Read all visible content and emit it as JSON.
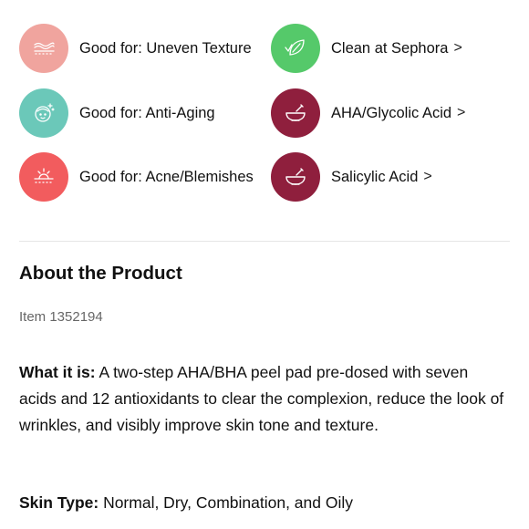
{
  "highlights": [
    {
      "label": "Good for: Uneven Texture",
      "icon": "uneven-texture-icon",
      "color": "#f0a49e",
      "link": false
    },
    {
      "label": "Clean at Sephora",
      "icon": "leaf-check-icon",
      "color": "#55c96a",
      "link": true
    },
    {
      "label": "Good for: Anti-Aging",
      "icon": "face-sparkle-icon",
      "color": "#6bc8b9",
      "link": false
    },
    {
      "label": "AHA/Glycolic Acid",
      "icon": "mortar-pestle-icon",
      "color": "#8f1f3d",
      "link": true
    },
    {
      "label": "Good for: Acne/Blemishes",
      "icon": "acne-burst-icon",
      "color": "#f25c5e",
      "link": false
    },
    {
      "label": "Salicylic Acid",
      "icon": "mortar-pestle-icon",
      "color": "#8f1f3d",
      "link": true
    }
  ],
  "chevron": ">",
  "about": {
    "title": "About the Product",
    "item_number": "Item 1352194",
    "what_it_is_label": "What it is:",
    "what_it_is_text": " A two-step AHA/BHA peel pad pre-dosed with seven acids and 12 antioxidants to clear the complexion, reduce the look of wrinkles, and visibly improve skin tone and texture.",
    "skin_type_label": "Skin Type:",
    "skin_type_text": " Normal, Dry, Combination, and Oily"
  }
}
